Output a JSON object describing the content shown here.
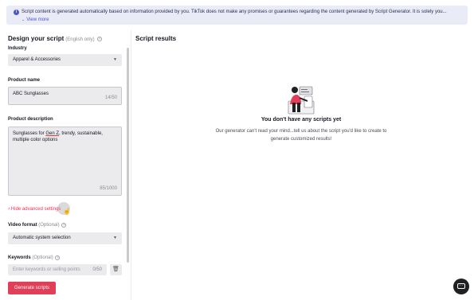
{
  "banner": {
    "icon": "info-icon",
    "message": "Script content is generated automatically based on information provided by you. TikTok does not make any promises or guarantees regarding the content generated by Script Generator. It is solely you...",
    "view_more": "View more"
  },
  "form": {
    "title": "Design your script",
    "title_note": "(English only)",
    "industry_label": "Industry",
    "industry_value": "Apparel & Accessories",
    "product_name_label": "Product name",
    "product_name_value": "ABC Sunglasses",
    "product_name_counter": "14/50",
    "product_desc_label": "Product description",
    "product_desc_pre": "Sunglasses for ",
    "product_desc_underlined": "Gen Z",
    "product_desc_post": ", trendy, sustainable, multiple color options",
    "product_desc_counter": "85/1000",
    "advanced_toggle": "Hide advanced settings",
    "video_format_label": "Video format",
    "video_format_optional": "(Optional)",
    "video_format_value": "Automatic system selection",
    "keywords_label": "Keywords",
    "keywords_optional": "(Optional)",
    "keywords_placeholder": "Enter keywords or selling points",
    "keywords_counter": "0/50",
    "generate_button": "Generate scripts"
  },
  "results": {
    "title": "Script results",
    "empty_title": "You don't have any scripts yet",
    "empty_message": "Our generator can't read your mind...tell us about the script you'd like to create to generate customized results!"
  },
  "colors": {
    "accent": "#fe2c55",
    "button": "#e13e57",
    "banner_bg": "#e9ebf7",
    "link": "#4a55c8"
  }
}
